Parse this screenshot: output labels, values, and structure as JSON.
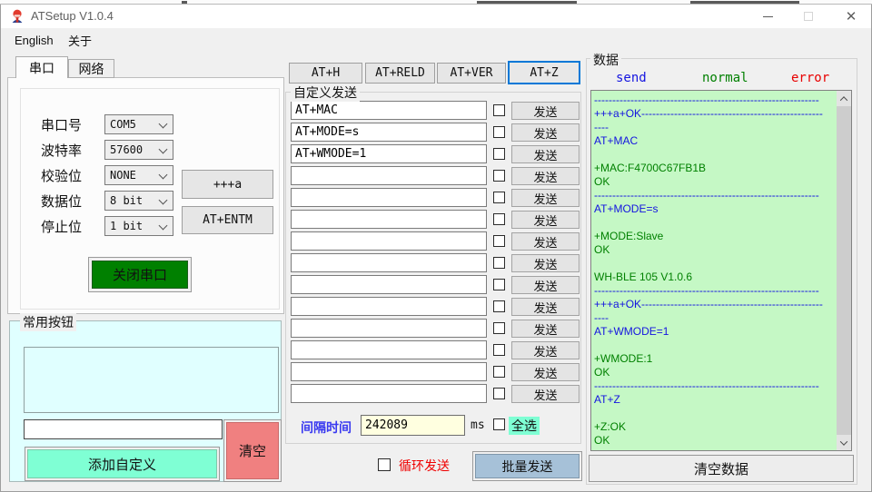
{
  "window": {
    "title": "ATSetup V1.0.4"
  },
  "menu": {
    "items": [
      {
        "label": "English"
      },
      {
        "label": "关于"
      }
    ]
  },
  "serial_panel": {
    "tabs": [
      {
        "label": "串口",
        "active": true
      },
      {
        "label": "网络",
        "active": false
      }
    ],
    "fields": [
      {
        "label": "串口号",
        "value": "COM5"
      },
      {
        "label": "波特率",
        "value": "57600"
      },
      {
        "label": "校验位",
        "value": "NONE"
      },
      {
        "label": "数据位",
        "value": "8 bit"
      },
      {
        "label": "停止位",
        "value": "1 bit"
      }
    ],
    "plus_a_button": "+++a",
    "entm_button": "AT+ENTM",
    "close_serial_button": "关闭串口"
  },
  "common_buttons": {
    "title": "常用按钮",
    "input_value": "",
    "add_custom_button": "添加自定义",
    "clear_button": "清空"
  },
  "quick_commands": [
    "AT+H",
    "AT+RELD",
    "AT+VER",
    "AT+Z"
  ],
  "custom_send": {
    "title": "自定义发送",
    "send_label": "发送",
    "rows": [
      {
        "value": "AT+MAC",
        "checked": false
      },
      {
        "value": "AT+MODE=s",
        "checked": false
      },
      {
        "value": "AT+WMODE=1",
        "checked": false
      },
      {
        "value": "",
        "checked": false
      },
      {
        "value": "",
        "checked": false
      },
      {
        "value": "",
        "checked": false
      },
      {
        "value": "",
        "checked": false
      },
      {
        "value": "",
        "checked": false
      },
      {
        "value": "",
        "checked": false
      },
      {
        "value": "",
        "checked": false
      },
      {
        "value": "",
        "checked": false
      },
      {
        "value": "",
        "checked": false
      },
      {
        "value": "",
        "checked": false
      },
      {
        "value": "",
        "checked": false
      }
    ],
    "interval_label": "间隔时间",
    "interval_value": "242089",
    "interval_unit": "ms",
    "select_all_label": "全选",
    "select_all_checked": false,
    "loop_send_label": "循环发送",
    "loop_send_checked": false,
    "batch_send_button": "批量发送"
  },
  "data_panel": {
    "title": "数据",
    "legend": [
      {
        "label": "send",
        "color": "#1414e0"
      },
      {
        "label": "normal",
        "color": "#008000"
      },
      {
        "label": "error",
        "color": "#e80000"
      }
    ],
    "log_lines": [
      {
        "text": "--------------------------------------------------------------",
        "color": "send"
      },
      {
        "text": "+++a+OK-------------------------------------------------------",
        "color": "send"
      },
      {
        "text": "----",
        "color": "send"
      },
      {
        "text": "AT+MAC",
        "color": "send"
      },
      {
        "text": "",
        "color": "send"
      },
      {
        "text": "+MAC:F4700C67FB1B",
        "color": "normal"
      },
      {
        "text": "OK",
        "color": "normal"
      },
      {
        "text": "--------------------------------------------------------------",
        "color": "send"
      },
      {
        "text": "AT+MODE=s",
        "color": "send"
      },
      {
        "text": "",
        "color": "send"
      },
      {
        "text": "+MODE:Slave",
        "color": "normal"
      },
      {
        "text": "OK",
        "color": "normal"
      },
      {
        "text": "",
        "color": "normal"
      },
      {
        "text": "WH-BLE 105 V1.0.6",
        "color": "normal"
      },
      {
        "text": "--------------------------------------------------------------",
        "color": "send"
      },
      {
        "text": "+++a+OK-------------------------------------------------------",
        "color": "send"
      },
      {
        "text": "----",
        "color": "send"
      },
      {
        "text": "AT+WMODE=1",
        "color": "send"
      },
      {
        "text": "",
        "color": "send"
      },
      {
        "text": "+WMODE:1",
        "color": "normal"
      },
      {
        "text": "OK",
        "color": "normal"
      },
      {
        "text": "--------------------------------------------------------------",
        "color": "send"
      },
      {
        "text": "AT+Z",
        "color": "send"
      },
      {
        "text": "",
        "color": "send"
      },
      {
        "text": "+Z:OK",
        "color": "normal"
      },
      {
        "text": "OK",
        "color": "normal"
      }
    ],
    "clear_data_button": "清空数据"
  },
  "colors": {
    "log_bg": "#c5f8c5",
    "send_blue": "#1414e0",
    "normal_green": "#008000",
    "error_red": "#e80000",
    "close_serial_green": "#008000",
    "add_custom_mint": "#7fffd4",
    "clear_pink": "#f08080",
    "batch_blue": "#a6c1d8",
    "group_cyan": "#e0ffff",
    "interval_yellow": "#ffffe0",
    "select_all_mint": "#7fffd4",
    "focus_blue": "#0078d7",
    "loop_red": "#ef0000",
    "interval_label_blue": "#3a3af0"
  }
}
